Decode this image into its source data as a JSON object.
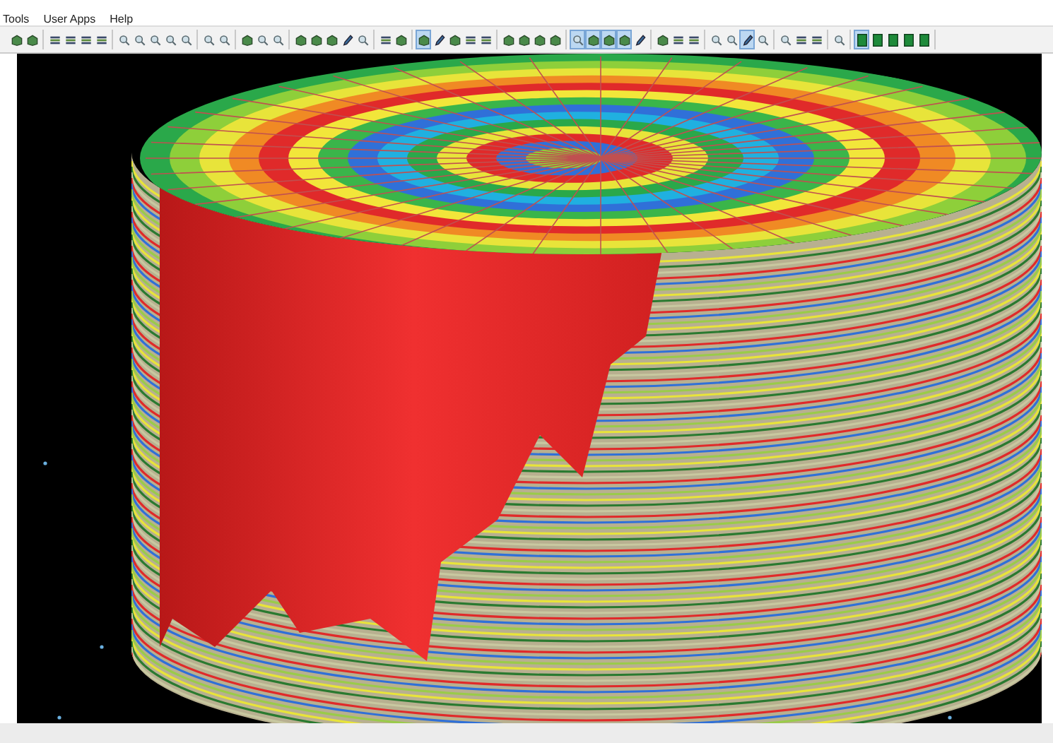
{
  "menu": [
    "Tools",
    "User Apps",
    "Help"
  ],
  "toolbar": [
    [
      {
        "kind": "cube",
        "pressed": false
      },
      {
        "kind": "cube",
        "pressed": false
      }
    ],
    [
      {
        "kind": "bars",
        "pressed": false
      },
      {
        "kind": "bars",
        "pressed": false
      },
      {
        "kind": "bars",
        "pressed": false
      },
      {
        "kind": "bars",
        "pressed": false
      }
    ],
    [
      {
        "kind": "magnifier",
        "pressed": false
      },
      {
        "kind": "magnifier",
        "pressed": false
      },
      {
        "kind": "magnifier",
        "pressed": false
      },
      {
        "kind": "magnifier",
        "pressed": false
      },
      {
        "kind": "magnifier",
        "pressed": false
      }
    ],
    [
      {
        "kind": "magnifier",
        "pressed": false
      },
      {
        "kind": "magnifier",
        "pressed": false
      }
    ],
    [
      {
        "kind": "cube",
        "pressed": false
      },
      {
        "kind": "magnifier",
        "pressed": false
      },
      {
        "kind": "magnifier",
        "pressed": false
      }
    ],
    [
      {
        "kind": "cube",
        "pressed": false
      },
      {
        "kind": "cube",
        "pressed": false
      },
      {
        "kind": "cube",
        "pressed": false
      },
      {
        "kind": "pen",
        "pressed": false
      },
      {
        "kind": "magnifier",
        "pressed": false
      }
    ],
    [
      {
        "kind": "bars",
        "pressed": false
      },
      {
        "kind": "cube",
        "pressed": false
      }
    ],
    [
      {
        "kind": "cube",
        "pressed": true
      },
      {
        "kind": "pen",
        "pressed": false
      },
      {
        "kind": "cube",
        "pressed": false
      },
      {
        "kind": "bars",
        "pressed": false
      },
      {
        "kind": "bars",
        "pressed": false
      }
    ],
    [
      {
        "kind": "cube",
        "pressed": false
      },
      {
        "kind": "cube",
        "pressed": false
      },
      {
        "kind": "cube",
        "pressed": false
      },
      {
        "kind": "cube",
        "pressed": false
      }
    ],
    [
      {
        "kind": "magnifier",
        "pressed": true
      },
      {
        "kind": "cube",
        "pressed": true
      },
      {
        "kind": "cube",
        "pressed": true
      },
      {
        "kind": "cube",
        "pressed": true
      },
      {
        "kind": "pen",
        "pressed": false
      }
    ],
    [
      {
        "kind": "cube",
        "pressed": false
      },
      {
        "kind": "bars",
        "pressed": false
      },
      {
        "kind": "bars",
        "pressed": false
      }
    ],
    [
      {
        "kind": "magnifier",
        "pressed": false
      },
      {
        "kind": "magnifier",
        "pressed": false
      },
      {
        "kind": "pen",
        "pressed": true
      },
      {
        "kind": "magnifier",
        "pressed": false
      }
    ],
    [
      {
        "kind": "magnifier",
        "pressed": false
      },
      {
        "kind": "bars",
        "pressed": false
      },
      {
        "kind": "bars",
        "pressed": false
      }
    ],
    [
      {
        "kind": "magnifier",
        "pressed": false
      }
    ],
    [
      {
        "kind": "tile",
        "pressed": true
      },
      {
        "kind": "tile",
        "pressed": false
      },
      {
        "kind": "tile",
        "pressed": false
      },
      {
        "kind": "tile",
        "pressed": false
      },
      {
        "kind": "tile",
        "pressed": false
      }
    ]
  ]
}
